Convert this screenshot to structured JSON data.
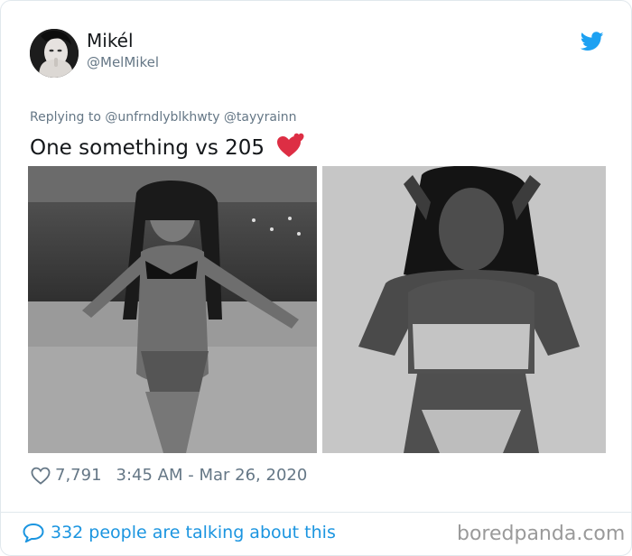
{
  "tweet": {
    "author": {
      "display_name": "Mikél",
      "handle": "@MelMikel",
      "avatar": "profile photo"
    },
    "platform_icon": "twitter-bird-icon",
    "replying_to": "Replying to @unfrndlyblkhwty @tayyrainn",
    "text": "One something vs 205",
    "emoji": "two-hearts-emoji",
    "images": [
      {
        "icon": "photo-left"
      },
      {
        "icon": "photo-right"
      }
    ],
    "likes": "7,791",
    "timestamp": "3:45 AM - Mar 26, 2020",
    "conversation_link": "332 people are talking about this"
  },
  "watermark": "boredpanda.com",
  "colors": {
    "twitter_blue": "#1da1f2",
    "link_blue": "#1b95e0",
    "secondary_text": "#657786",
    "primary_text": "#14171a",
    "border": "#e1e8ed",
    "emoji_red": "#dd2e44"
  }
}
